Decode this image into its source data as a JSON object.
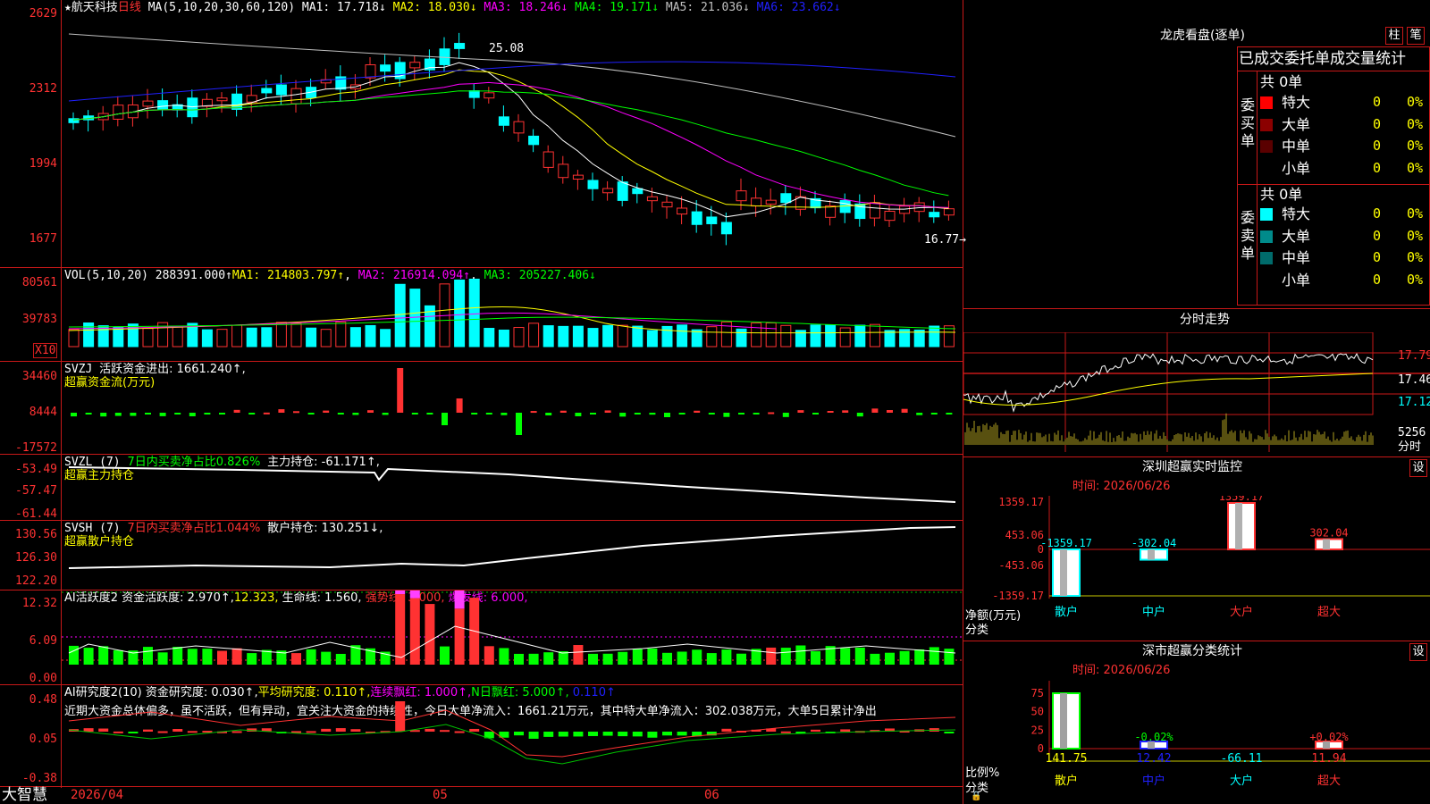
{
  "kline": {
    "title": "航天科技",
    "period": "日线",
    "ma_label": "MA(5,10,20,30,60,120)",
    "ma": [
      {
        "label": "MA1: 17.718↓",
        "color": "#ffffff"
      },
      {
        "label": "MA2: 18.030↓",
        "color": "#ffff00"
      },
      {
        "label": "MA3: 18.246↓",
        "color": "#ff00ff"
      },
      {
        "label": "MA4: 19.171↓",
        "color": "#00ff00"
      },
      {
        "label": "MA5: 21.036↓",
        "color": "#c0c0c0"
      },
      {
        "label": "MA6: 23.662↓",
        "color": "#2020ff"
      }
    ],
    "y_ticks": [
      "2629",
      "2312",
      "1994",
      "1677"
    ],
    "high_label": "25.08",
    "low_label": "16.77→"
  },
  "vol": {
    "title": "VOL(5,10,20)",
    "value": "288391.000↑",
    "ma1": "MA1: 214803.797↑",
    "ma2": "MA2: 216914.094↑",
    "ma3": "MA3: 205227.406↓",
    "y_ticks": [
      "80561",
      "39783"
    ],
    "unit": "X10"
  },
  "svzj": {
    "title": "SVZJ",
    "line1": "活跃资金进出: 1661.240↑,",
    "line2": "超赢资金流(万元)",
    "y_ticks": [
      "34460",
      "8444",
      "-17572"
    ]
  },
  "svzl": {
    "title": "SVZL (7)",
    "part1": "7日内买卖净占比0.826%",
    "part2": "主力持仓: -61.171↑,",
    "line2": "超赢主力持仓",
    "y_ticks": [
      "-53.49",
      "-57.47",
      "-61.44"
    ]
  },
  "svsh": {
    "title": "SVSH (7)",
    "part1": "7日内买卖净占比1.044%",
    "part2": "散户持仓: 130.251↓,",
    "line2": "超赢散户持仓",
    "y_ticks": [
      "130.56",
      "126.30",
      "122.20"
    ]
  },
  "ai1": {
    "title": "AI活跃度2",
    "a": "资金活跃度: 2.970↑,",
    "b": "12.323,",
    "c": "生命线: 1.560,",
    "d": "强势线: 3.000,",
    "e": "爆发线: 6.000,",
    "y_ticks": [
      "12.32",
      "6.09",
      "0.00"
    ]
  },
  "ai2": {
    "title": "AI研究度2(10)",
    "a": "资金研究度: 0.030↑,",
    "b": "平均研究度: 0.110↑,",
    "c": "连续飘红: 1.000↑,",
    "d": "N日飘红: 5.000↑,",
    "e": "0.110↑",
    "comment": "近期大资金总体偏多，虽不活跃，但有异动，宜关注大资金的持续性，今日大单净流入：1661.21万元，其中特大单净流入：302.038万元，大单5日累计净出",
    "y_ticks": [
      "0.48",
      "0.05",
      "-0.38"
    ]
  },
  "footer": {
    "brand": "大智慧",
    "date": "2026/04",
    "m05": "05",
    "m06": "06"
  },
  "lhb": {
    "title": "龙虎看盘(逐单)",
    "btn1": "柱",
    "btn2": "笔",
    "header": "已成交委托单成交量统计",
    "buy_label": "委买单",
    "sell_label": "委卖单",
    "buy_total": "共 0单",
    "sell_total": "共 0单",
    "buy_rows": [
      {
        "name": "特大",
        "count": "0",
        "pct": "0%",
        "color": "#ff0000"
      },
      {
        "name": "大单",
        "count": "0",
        "pct": "0%",
        "color": "#8b0000"
      },
      {
        "name": "中单",
        "count": "0",
        "pct": "0%",
        "color": "#5a0000"
      },
      {
        "name": "小单",
        "count": "0",
        "pct": "0%",
        "color": ""
      }
    ],
    "sell_rows": [
      {
        "name": "特大",
        "count": "0",
        "pct": "0%",
        "color": "#00ffff"
      },
      {
        "name": "大单",
        "count": "0",
        "pct": "0%",
        "color": "#008b8b"
      },
      {
        "name": "中单",
        "count": "0",
        "pct": "0%",
        "color": "#006b6b"
      },
      {
        "name": "小单",
        "count": "0",
        "pct": "0%",
        "color": ""
      }
    ]
  },
  "fenshi": {
    "title": "分时走势",
    "y_ticks": [
      "17.79",
      "17.46",
      "17.12"
    ],
    "vol_tick": "5256",
    "vol_label": "分时"
  },
  "sz_monitor": {
    "title": "深圳超赢实时监控",
    "btn": "设",
    "time": "时间: 2026/06/26",
    "y_ticks": [
      "1359.17",
      "453.06",
      "0",
      "-453.06",
      "-1359.17"
    ],
    "bars": [
      {
        "name": "散户",
        "value": -1359.17,
        "label": "-1359.17"
      },
      {
        "name": "中户",
        "value": -302.04,
        "label": "-302.04"
      },
      {
        "name": "大户",
        "value": 1359.17,
        "label": "1359.17"
      },
      {
        "name": "超大",
        "value": 302.04,
        "label": "302.04"
      }
    ],
    "axis_label1": "净额(万元)",
    "axis_label2": "分类"
  },
  "sz_class": {
    "title": "深市超赢分类统计",
    "btn": "设",
    "time": "时间: 2026/06/26",
    "y_ticks": [
      "75",
      "50",
      "25",
      "0"
    ],
    "bars": [
      {
        "name": "散户",
        "value": 141.75,
        "top_label": "",
        "bottom": "141.75"
      },
      {
        "name": "中户",
        "value": 12.42,
        "top_label": "-0.02%",
        "bottom": "12.42"
      },
      {
        "name": "大户",
        "value": -66.11,
        "top_label": "",
        "bottom": "-66.11"
      },
      {
        "name": "超大",
        "value": 11.94,
        "top_label": "+0.02%",
        "bottom": "11.94"
      }
    ],
    "axis_label1": "比例%",
    "axis_label2": "分类"
  }
}
